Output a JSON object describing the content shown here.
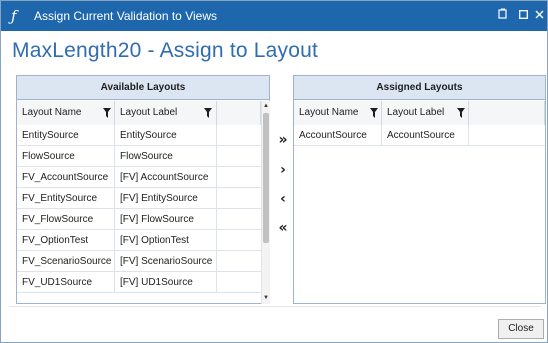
{
  "window": {
    "title": "Assign Current Validation to Views",
    "app_icon": "validation-script-icon",
    "controls": [
      "restore-icon",
      "maximize-icon",
      "close-icon"
    ]
  },
  "page": {
    "heading": "MaxLength20 - Assign to Layout"
  },
  "available": {
    "title": "Available Layouts",
    "columns": [
      "Layout Name",
      "Layout Label"
    ],
    "rows": [
      [
        "EntitySource",
        "EntitySource"
      ],
      [
        "FlowSource",
        "FlowSource"
      ],
      [
        "FV_AccountSource",
        "[FV] AccountSource"
      ],
      [
        "FV_EntitySource",
        "[FV] EntitySource"
      ],
      [
        "FV_FlowSource",
        "[FV] FlowSource"
      ],
      [
        "FV_OptionTest",
        "[FV] OptionTest"
      ],
      [
        "FV_ScenarioSource",
        "[FV] ScenarioSource"
      ],
      [
        "FV_UD1Source",
        "[FV] UD1Source"
      ]
    ]
  },
  "assigned": {
    "title": "Assigned Layouts",
    "columns": [
      "Layout Name",
      "Layout Label"
    ],
    "rows": [
      [
        "AccountSource",
        "AccountSource"
      ]
    ]
  },
  "actions": {
    "assign_all": "»",
    "assign": "›",
    "unassign": "‹",
    "unassign_all": "«"
  },
  "footer": {
    "close_label": "Close"
  },
  "colors": {
    "titlebar": "#1e67ad",
    "heading": "#2f6db2",
    "panel_header": "#dce6f2"
  }
}
